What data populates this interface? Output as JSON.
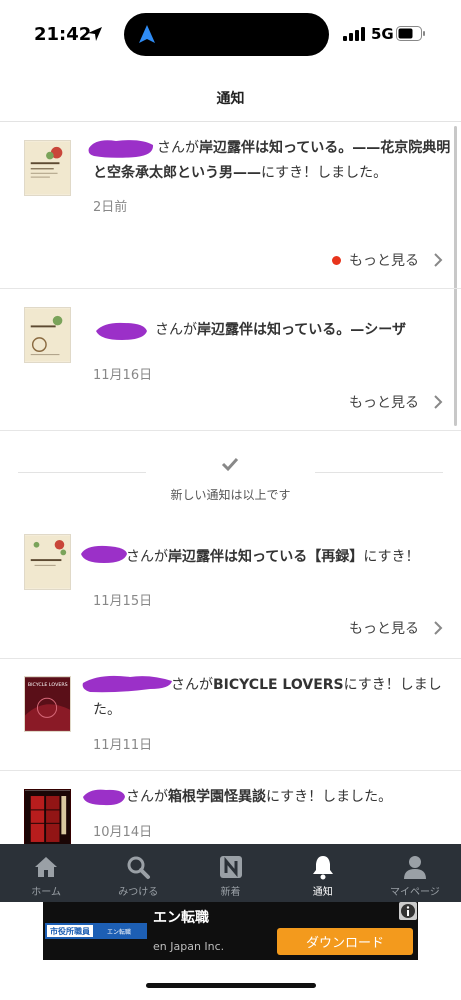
{
  "status_bar": {
    "time": "21:42",
    "network": "5G"
  },
  "header": {
    "title": "通知"
  },
  "notifications": [
    {
      "title_segments": [
        "さんが",
        "岸辺露伴は知っている。——花京院典明と空条承太郎という男——",
        "にすき！しました。"
      ],
      "date": "2日前",
      "more_label": "もっと見る",
      "unread": true
    },
    {
      "title_segments": [
        "さんが",
        "岸辺露伴は知っている。—シーザ",
        ""
      ],
      "date": "11月16日",
      "more_label": "もっと見る",
      "unread": false
    },
    {
      "title_segments": [
        "さんが",
        "岸辺露伴は知っている【再録】",
        "にすき！"
      ],
      "date": "11月15日",
      "more_label": "もっと見る",
      "unread": false
    },
    {
      "title_segments": [
        "さんが",
        "BICYCLE LOVERS",
        "にすき！しました。"
      ],
      "date": "11月11日",
      "unread": false
    },
    {
      "title_segments": [
        "さんが",
        "箱根学園怪異談",
        "にすき！しました。"
      ],
      "date": "10月14日",
      "unread": false
    }
  ],
  "divider": {
    "text": "新しい通知は以上です"
  },
  "thumbnail_text": {
    "bicycle": "BICYCLE LOVERS"
  },
  "bottom_nav": [
    {
      "label": "ホーム",
      "icon": "home-icon"
    },
    {
      "label": "みつける",
      "icon": "search-icon"
    },
    {
      "label": "新着",
      "icon": "new-icon"
    },
    {
      "label": "通知",
      "icon": "bell-icon",
      "active": true
    },
    {
      "label": "マイページ",
      "icon": "person-icon"
    }
  ],
  "ad": {
    "logo_text": "市役所職員",
    "logo_sub": "エン転職",
    "title": "エン転職",
    "sub": "en Japan Inc.",
    "button": "ダウンロード"
  },
  "colors": {
    "accent_dot": "#e8341c",
    "nav_bg": "#2b3138",
    "ad_button": "#f39a1d",
    "scribble": "#9b30c8"
  }
}
